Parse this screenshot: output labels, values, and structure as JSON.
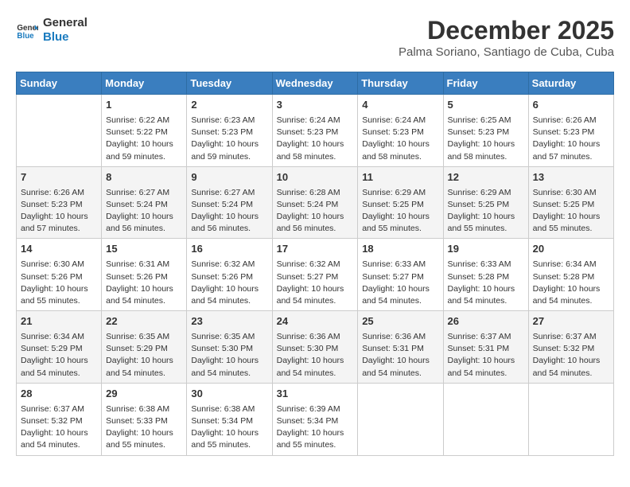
{
  "logo": {
    "line1": "General",
    "line2": "Blue"
  },
  "title": "December 2025",
  "subtitle": "Palma Soriano, Santiago de Cuba, Cuba",
  "days_of_week": [
    "Sunday",
    "Monday",
    "Tuesday",
    "Wednesday",
    "Thursday",
    "Friday",
    "Saturday"
  ],
  "weeks": [
    [
      {
        "day": "",
        "info": ""
      },
      {
        "day": "1",
        "info": "Sunrise: 6:22 AM\nSunset: 5:22 PM\nDaylight: 10 hours\nand 59 minutes."
      },
      {
        "day": "2",
        "info": "Sunrise: 6:23 AM\nSunset: 5:23 PM\nDaylight: 10 hours\nand 59 minutes."
      },
      {
        "day": "3",
        "info": "Sunrise: 6:24 AM\nSunset: 5:23 PM\nDaylight: 10 hours\nand 58 minutes."
      },
      {
        "day": "4",
        "info": "Sunrise: 6:24 AM\nSunset: 5:23 PM\nDaylight: 10 hours\nand 58 minutes."
      },
      {
        "day": "5",
        "info": "Sunrise: 6:25 AM\nSunset: 5:23 PM\nDaylight: 10 hours\nand 58 minutes."
      },
      {
        "day": "6",
        "info": "Sunrise: 6:26 AM\nSunset: 5:23 PM\nDaylight: 10 hours\nand 57 minutes."
      }
    ],
    [
      {
        "day": "7",
        "info": "Sunrise: 6:26 AM\nSunset: 5:23 PM\nDaylight: 10 hours\nand 57 minutes."
      },
      {
        "day": "8",
        "info": "Sunrise: 6:27 AM\nSunset: 5:24 PM\nDaylight: 10 hours\nand 56 minutes."
      },
      {
        "day": "9",
        "info": "Sunrise: 6:27 AM\nSunset: 5:24 PM\nDaylight: 10 hours\nand 56 minutes."
      },
      {
        "day": "10",
        "info": "Sunrise: 6:28 AM\nSunset: 5:24 PM\nDaylight: 10 hours\nand 56 minutes."
      },
      {
        "day": "11",
        "info": "Sunrise: 6:29 AM\nSunset: 5:25 PM\nDaylight: 10 hours\nand 55 minutes."
      },
      {
        "day": "12",
        "info": "Sunrise: 6:29 AM\nSunset: 5:25 PM\nDaylight: 10 hours\nand 55 minutes."
      },
      {
        "day": "13",
        "info": "Sunrise: 6:30 AM\nSunset: 5:25 PM\nDaylight: 10 hours\nand 55 minutes."
      }
    ],
    [
      {
        "day": "14",
        "info": "Sunrise: 6:30 AM\nSunset: 5:26 PM\nDaylight: 10 hours\nand 55 minutes."
      },
      {
        "day": "15",
        "info": "Sunrise: 6:31 AM\nSunset: 5:26 PM\nDaylight: 10 hours\nand 54 minutes."
      },
      {
        "day": "16",
        "info": "Sunrise: 6:32 AM\nSunset: 5:26 PM\nDaylight: 10 hours\nand 54 minutes."
      },
      {
        "day": "17",
        "info": "Sunrise: 6:32 AM\nSunset: 5:27 PM\nDaylight: 10 hours\nand 54 minutes."
      },
      {
        "day": "18",
        "info": "Sunrise: 6:33 AM\nSunset: 5:27 PM\nDaylight: 10 hours\nand 54 minutes."
      },
      {
        "day": "19",
        "info": "Sunrise: 6:33 AM\nSunset: 5:28 PM\nDaylight: 10 hours\nand 54 minutes."
      },
      {
        "day": "20",
        "info": "Sunrise: 6:34 AM\nSunset: 5:28 PM\nDaylight: 10 hours\nand 54 minutes."
      }
    ],
    [
      {
        "day": "21",
        "info": "Sunrise: 6:34 AM\nSunset: 5:29 PM\nDaylight: 10 hours\nand 54 minutes."
      },
      {
        "day": "22",
        "info": "Sunrise: 6:35 AM\nSunset: 5:29 PM\nDaylight: 10 hours\nand 54 minutes."
      },
      {
        "day": "23",
        "info": "Sunrise: 6:35 AM\nSunset: 5:30 PM\nDaylight: 10 hours\nand 54 minutes."
      },
      {
        "day": "24",
        "info": "Sunrise: 6:36 AM\nSunset: 5:30 PM\nDaylight: 10 hours\nand 54 minutes."
      },
      {
        "day": "25",
        "info": "Sunrise: 6:36 AM\nSunset: 5:31 PM\nDaylight: 10 hours\nand 54 minutes."
      },
      {
        "day": "26",
        "info": "Sunrise: 6:37 AM\nSunset: 5:31 PM\nDaylight: 10 hours\nand 54 minutes."
      },
      {
        "day": "27",
        "info": "Sunrise: 6:37 AM\nSunset: 5:32 PM\nDaylight: 10 hours\nand 54 minutes."
      }
    ],
    [
      {
        "day": "28",
        "info": "Sunrise: 6:37 AM\nSunset: 5:32 PM\nDaylight: 10 hours\nand 54 minutes."
      },
      {
        "day": "29",
        "info": "Sunrise: 6:38 AM\nSunset: 5:33 PM\nDaylight: 10 hours\nand 55 minutes."
      },
      {
        "day": "30",
        "info": "Sunrise: 6:38 AM\nSunset: 5:34 PM\nDaylight: 10 hours\nand 55 minutes."
      },
      {
        "day": "31",
        "info": "Sunrise: 6:39 AM\nSunset: 5:34 PM\nDaylight: 10 hours\nand 55 minutes."
      },
      {
        "day": "",
        "info": ""
      },
      {
        "day": "",
        "info": ""
      },
      {
        "day": "",
        "info": ""
      }
    ]
  ]
}
